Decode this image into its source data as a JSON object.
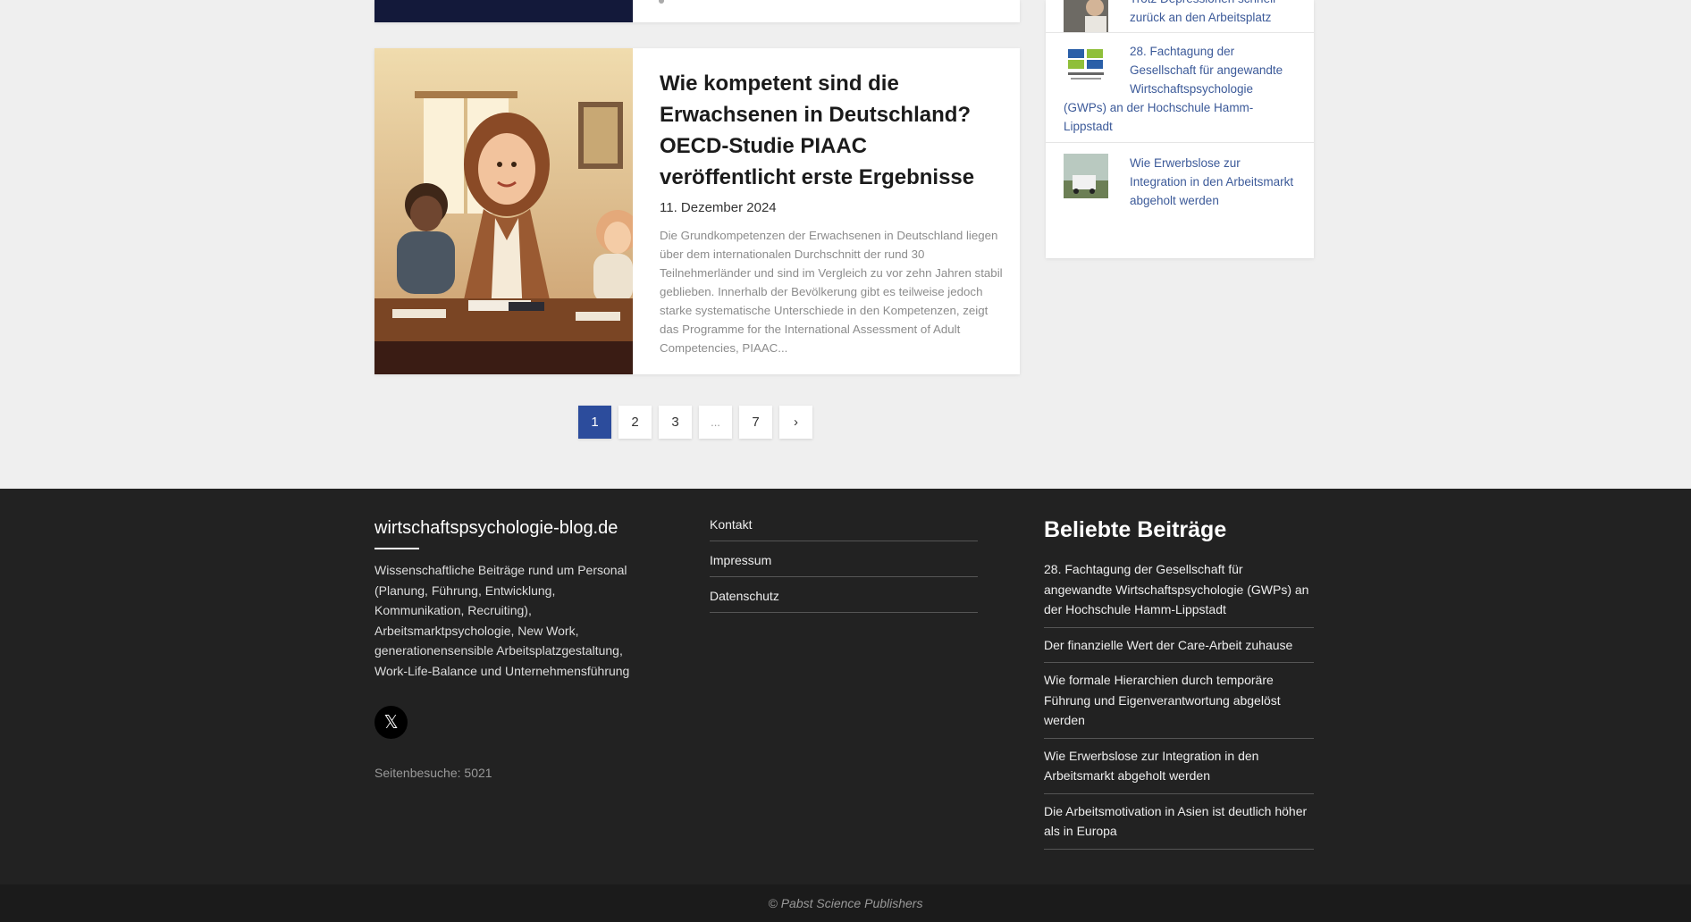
{
  "article": {
    "title": "Wie kompetent sind die Erwachsenen in Deutschland? OECD-Studie PIAAC veröffentlicht erste Ergebnisse",
    "date": "11. Dezember 2024",
    "excerpt": "Die Grundkompetenzen der Erwachsenen in Deutschland liegen über dem internationalen Durchschnitt der rund 30 Teilnehmerländer und sind im Vergleich zu vor zehn Jahren stabil geblieben. Innerhalb der Bevölkerung gibt es teilweise jedoch starke systematische Unterschiede in den Kompetenzen, zeigt das Programme for the International Assessment of Adult Competencies, PIAAC..."
  },
  "sidebar": {
    "items": [
      {
        "label": "Trotz Depressionen schnell zurück an den Arbeitsplatz"
      },
      {
        "label": "28. Fachtagung der Gesellschaft für angewandte Wirtschaftspsychologie (GWPs) an der Hochschule Hamm-Lippstadt"
      },
      {
        "label": "Wie Erwerbslose zur Integration in den Arbeitsmarkt abgeholt werden"
      }
    ]
  },
  "pagination": {
    "pages": [
      "1",
      "2",
      "3",
      "...",
      "7"
    ],
    "next": "›"
  },
  "footer": {
    "site_title": "wirtschaftspsychologie-blog.de",
    "site_desc": "Wissenschaftliche Beiträge rund um Personal (Planung, Führung, Entwicklung, Kommunikation, Recruiting), Arbeitsmarktpsychologie, New Work, generationensensible Arbeitsplatzgestaltung, Work-Life-Balance und Unternehmensführung",
    "x_label": "𝕏",
    "visits": "Seitenbesuche: 5021",
    "links": [
      "Kontakt",
      "Impressum",
      "Datenschutz"
    ],
    "popular_heading": "Beliebte Beiträge",
    "popular": [
      "28. Fachtagung der Gesellschaft für angewandte Wirtschaftspsychologie (GWPs) an der Hochschule Hamm-Lippstadt",
      "Der finanzielle Wert der Care-Arbeit zuhause",
      "Wie formale Hierarchien durch temporäre Führung und Eigenverantwortung abgelöst werden",
      "Wie Erwerbslose zur Integration in den Arbeitsmarkt abgeholt werden",
      "Die Arbeitsmotivation in Asien ist deutlich höher als in Europa"
    ],
    "copyright": "© Pabst Science Publishers"
  }
}
